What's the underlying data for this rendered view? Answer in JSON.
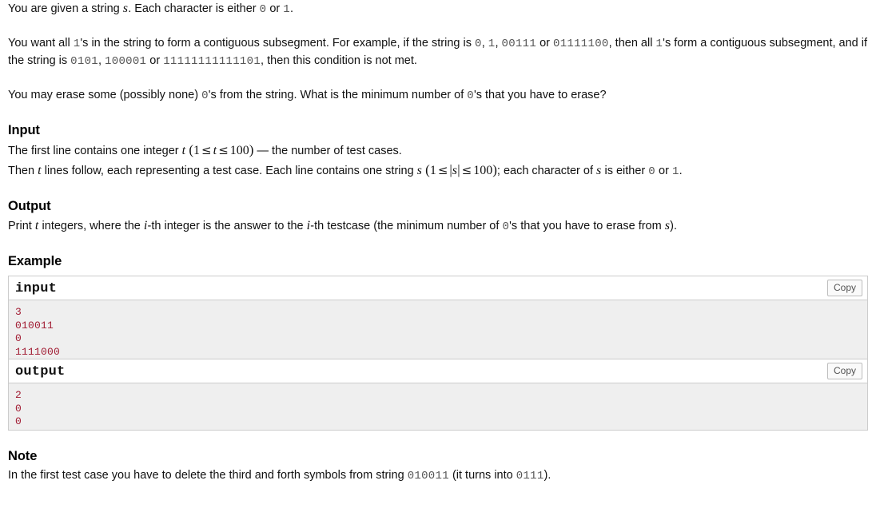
{
  "statement": {
    "paragraphs": [
      {
        "id": "p1",
        "parts": [
          {
            "t": "text",
            "v": "You are given a string "
          },
          {
            "t": "math",
            "v": "s"
          },
          {
            "t": "text",
            "v": ". Each character is either "
          },
          {
            "t": "code",
            "v": "0"
          },
          {
            "t": "text",
            "v": " or "
          },
          {
            "t": "code",
            "v": "1"
          },
          {
            "t": "text",
            "v": "."
          }
        ]
      },
      {
        "id": "p2",
        "parts": [
          {
            "t": "text",
            "v": "You want all "
          },
          {
            "t": "code",
            "v": "1"
          },
          {
            "t": "text",
            "v": "'s in the string to form a contiguous subsegment. For example, if the string is "
          },
          {
            "t": "code",
            "v": "0"
          },
          {
            "t": "text",
            "v": ", "
          },
          {
            "t": "code",
            "v": "1"
          },
          {
            "t": "text",
            "v": ", "
          },
          {
            "t": "code",
            "v": "00111"
          },
          {
            "t": "text",
            "v": " or "
          },
          {
            "t": "code",
            "v": "01111100"
          },
          {
            "t": "text",
            "v": ", then all "
          },
          {
            "t": "code",
            "v": "1"
          },
          {
            "t": "text",
            "v": "'s form a contiguous subsegment, and if the string is "
          },
          {
            "t": "code",
            "v": "0101"
          },
          {
            "t": "text",
            "v": ", "
          },
          {
            "t": "code",
            "v": "100001"
          },
          {
            "t": "text",
            "v": " or "
          },
          {
            "t": "code",
            "v": "11111111111101"
          },
          {
            "t": "text",
            "v": ", then this condition is not met."
          }
        ]
      },
      {
        "id": "p3",
        "parts": [
          {
            "t": "text",
            "v": "You may erase some (possibly none) "
          },
          {
            "t": "code",
            "v": "0"
          },
          {
            "t": "text",
            "v": "'s from the string. What is the minimum number of "
          },
          {
            "t": "code",
            "v": "0"
          },
          {
            "t": "text",
            "v": "'s that you have to erase?"
          }
        ]
      }
    ]
  },
  "input_section": {
    "title": "Input",
    "paragraphs": [
      {
        "id": "in1",
        "parts": [
          {
            "t": "text",
            "v": "The first line contains one integer "
          },
          {
            "t": "math",
            "v": "t"
          },
          {
            "t": "text",
            "v": " "
          },
          {
            "t": "paren",
            "v": "("
          },
          {
            "t": "num",
            "v": "1"
          },
          {
            "t": "rel",
            "v": "≤"
          },
          {
            "t": "math",
            "v": "t"
          },
          {
            "t": "rel",
            "v": "≤"
          },
          {
            "t": "num",
            "v": "100"
          },
          {
            "t": "paren",
            "v": ")"
          },
          {
            "t": "text",
            "v": " — the number of test cases."
          }
        ]
      },
      {
        "id": "in2",
        "parts": [
          {
            "t": "text",
            "v": "Then "
          },
          {
            "t": "math",
            "v": "t"
          },
          {
            "t": "text",
            "v": " lines follow, each representing a test case. Each line contains one string "
          },
          {
            "t": "math",
            "v": "s"
          },
          {
            "t": "text",
            "v": " "
          },
          {
            "t": "paren",
            "v": "("
          },
          {
            "t": "num",
            "v": "1"
          },
          {
            "t": "rel",
            "v": "≤"
          },
          {
            "t": "bar",
            "v": "|"
          },
          {
            "t": "math",
            "v": "s"
          },
          {
            "t": "bar",
            "v": "|"
          },
          {
            "t": "rel",
            "v": "≤"
          },
          {
            "t": "num",
            "v": "100"
          },
          {
            "t": "paren",
            "v": ")"
          },
          {
            "t": "text",
            "v": "; each character of "
          },
          {
            "t": "math",
            "v": "s"
          },
          {
            "t": "text",
            "v": " is either "
          },
          {
            "t": "code",
            "v": "0"
          },
          {
            "t": "text",
            "v": " or "
          },
          {
            "t": "code",
            "v": "1"
          },
          {
            "t": "text",
            "v": "."
          }
        ]
      }
    ]
  },
  "output_section": {
    "title": "Output",
    "paragraphs": [
      {
        "id": "out1",
        "parts": [
          {
            "t": "text",
            "v": "Print "
          },
          {
            "t": "math",
            "v": "t"
          },
          {
            "t": "text",
            "v": " integers, where the "
          },
          {
            "t": "math",
            "v": "i"
          },
          {
            "t": "text",
            "v": "-th integer is the answer to the "
          },
          {
            "t": "math",
            "v": "i"
          },
          {
            "t": "text",
            "v": "-th testcase (the minimum number of "
          },
          {
            "t": "code",
            "v": "0"
          },
          {
            "t": "text",
            "v": "'s that you have to erase from "
          },
          {
            "t": "math",
            "v": "s"
          },
          {
            "t": "text",
            "v": ")."
          }
        ]
      }
    ]
  },
  "example_section": {
    "title": "Example",
    "samples": [
      {
        "label": "input",
        "copy_label": "Copy",
        "content": "3\n010011\n0\n1111000"
      },
      {
        "label": "output",
        "copy_label": "Copy",
        "content": "2\n0\n0"
      }
    ]
  },
  "note_section": {
    "title": "Note",
    "paragraphs": [
      {
        "id": "n1",
        "parts": [
          {
            "t": "text",
            "v": "In the first test case you have to delete the third and forth symbols from string "
          },
          {
            "t": "code",
            "v": "010011"
          },
          {
            "t": "text",
            "v": " (it turns into "
          },
          {
            "t": "code",
            "v": "0111"
          },
          {
            "t": "text",
            "v": ")."
          }
        ]
      }
    ]
  },
  "colors": {
    "sample_text": "#a11b32",
    "sample_body_bg": "#efefef",
    "inline_code": "#555555",
    "border": "#cccccc"
  }
}
